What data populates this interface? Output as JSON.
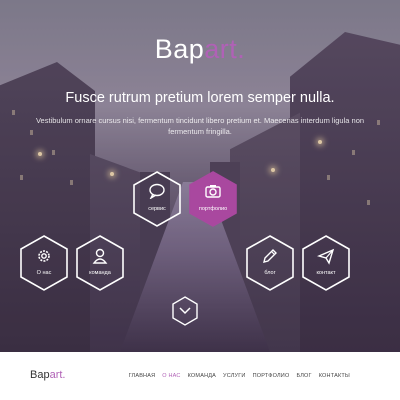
{
  "brand": {
    "name": "Bapart",
    "accent": "art",
    "dot": ".",
    "prefix": "Bap",
    "accent_color": "#b061b6"
  },
  "hero": {
    "headline": "Fusce rutrum pretium lorem semper nulla.",
    "subtext": "Vestibulum ornare cursus nisi, fermentum tincidunt libero pretium et. Maecenas interdum ligula non fermentum fringilla."
  },
  "hexes": [
    {
      "id": "service",
      "label": "сервис",
      "icon": "chat-bubble-icon",
      "active": false
    },
    {
      "id": "portfolio",
      "label": "портфолио",
      "icon": "camera-icon",
      "active": true
    },
    {
      "id": "about",
      "label": "О нас",
      "icon": "gear-icon",
      "active": false
    },
    {
      "id": "team",
      "label": "команда",
      "icon": "user-icon",
      "active": false
    },
    {
      "id": "blog",
      "label": "блог",
      "icon": "pencil-icon",
      "active": false
    },
    {
      "id": "contact",
      "label": "контакт",
      "icon": "paper-plane-icon",
      "active": false
    }
  ],
  "scroll": {
    "icon": "chevron-down-icon"
  },
  "nav": {
    "logo_prefix": "Bap",
    "logo_accent": "art",
    "logo_dot": ".",
    "items": [
      {
        "label": "ГЛАВНАЯ",
        "active": false
      },
      {
        "label": "О НАС",
        "active": true
      },
      {
        "label": "КОМАНДА",
        "active": false
      },
      {
        "label": "УСЛУГИ",
        "active": false
      },
      {
        "label": "ПОРТФОЛИО",
        "active": false
      },
      {
        "label": "БЛОГ",
        "active": false
      },
      {
        "label": "КОНТАКТЫ",
        "active": false
      }
    ]
  }
}
